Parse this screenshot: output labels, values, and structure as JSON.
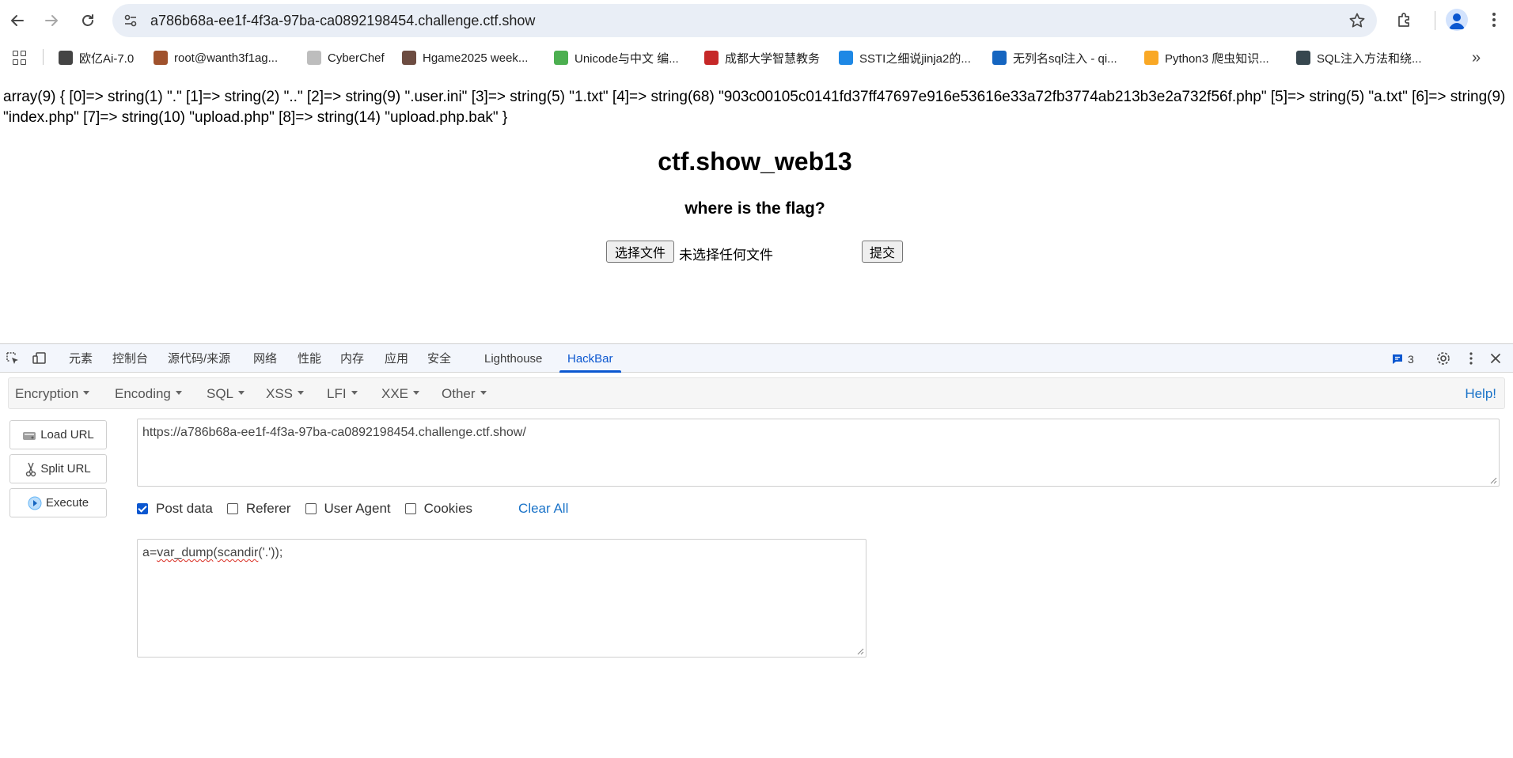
{
  "browser": {
    "url": "a786b68a-ee1f-4f3a-97ba-ca0892198454.challenge.ctf.show"
  },
  "bookmarks": [
    {
      "label": "欧亿Ai-7.0",
      "icon": "robot-icon",
      "color": "#444444"
    },
    {
      "label": "root@wanth3f1ag...",
      "icon": "avatar-icon",
      "color": "#a0522d"
    },
    {
      "label": "CyberChef",
      "icon": "chef-hat-icon",
      "color": "#bdbdbd"
    },
    {
      "label": "Hgame2025 week...",
      "icon": "person-icon",
      "color": "#6d4c41"
    },
    {
      "label": "Unicode与中文 编...",
      "icon": "t-icon",
      "color": "#4caf50"
    },
    {
      "label": "成都大学智慧教务",
      "icon": "seal-icon",
      "color": "#c62828"
    },
    {
      "label": "SSTI之细说jinja2的...",
      "icon": "wave-icon",
      "color": "#1e88e5"
    },
    {
      "label": "无列名sql注入 - qi...",
      "icon": "circle-icon",
      "color": "#1565c0"
    },
    {
      "label": "Python3 爬虫知识...",
      "icon": "biohazard-icon",
      "color": "#f9a825"
    },
    {
      "label": "SQL注入方法和绕...",
      "icon": "image-icon",
      "color": "#37474f"
    }
  ],
  "page": {
    "dump": "array(9) { [0]=> string(1) \".\" [1]=> string(2) \"..\" [2]=> string(9) \".user.ini\" [3]=> string(5) \"1.txt\" [4]=> string(68) \"903c00105c0141fd37ff47697e916e53616e33a72fb3774ab213b3e2a732f56f.php\" [5]=> string(5) \"a.txt\" [6]=> string(9) \"index.php\" [7]=> string(10) \"upload.php\" [8]=> string(14) \"upload.php.bak\" }",
    "title": "ctf.show_web13",
    "subtitle": "where is the flag?",
    "file_button": "选择文件",
    "file_status": "未选择任何文件",
    "submit_button": "提交"
  },
  "devtools": {
    "tabs": [
      "元素",
      "控制台",
      "源代码/来源",
      "网络",
      "性能",
      "内存",
      "应用",
      "安全",
      "Lighthouse",
      "HackBar"
    ],
    "active_tab": "HackBar",
    "issues_count": "3",
    "accent": "#0b57d0"
  },
  "hackbar": {
    "menus": [
      "Encryption",
      "Encoding",
      "SQL",
      "XSS",
      "LFI",
      "XXE",
      "Other"
    ],
    "help": "Help!",
    "load_url": "Load URL",
    "split_url": "Split URL",
    "execute": "Execute",
    "url_value": "https://a786b68a-ee1f-4f3a-97ba-ca0892198454.challenge.ctf.show/",
    "options": {
      "post_data": {
        "label": "Post data",
        "checked": true
      },
      "referer": {
        "label": "Referer",
        "checked": false
      },
      "user_agent": {
        "label": "User Agent",
        "checked": false
      },
      "cookies": {
        "label": "Cookies",
        "checked": false
      }
    },
    "clear_all": "Clear All",
    "post_prefix": "a=",
    "post_func1": "var_dump",
    "post_paren": "(",
    "post_func2": "scandir",
    "post_rest": "('.'));"
  }
}
